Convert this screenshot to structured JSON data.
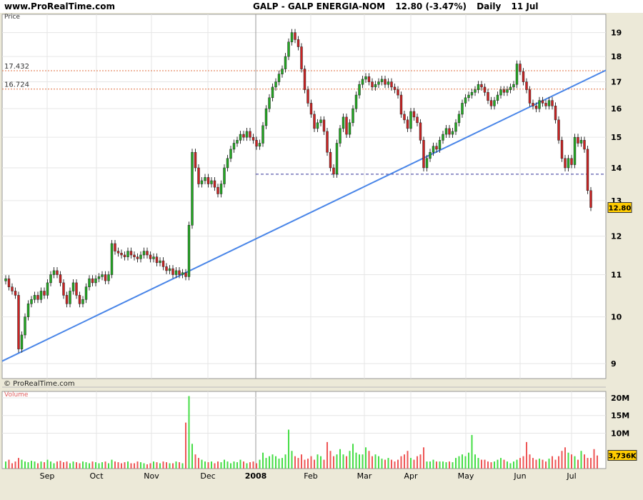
{
  "header": {
    "site": "www.ProRealTime.com",
    "symbol": "GALP - GALP ENERGIA-NOM",
    "quote": "12.80 (-3.47%)",
    "period": "Daily",
    "date": "11 Jul"
  },
  "panel_labels": {
    "price": "Price",
    "volume": "Volume",
    "copyright": "© ProRealTime.com"
  },
  "colors": {
    "up": "#22aa22",
    "down": "#cc2222",
    "trendline": "#4a86e8",
    "level": "#e07040",
    "support": "#333399",
    "vol_up": "#44dd44",
    "vol_down": "#ee5555"
  },
  "chart_data": [
    {
      "type": "candlestick",
      "title": "GALP - GALP ENERGIA-NOM",
      "ylabel": "Price",
      "y_scale": "log",
      "ylim": [
        8.7,
        19.8
      ],
      "y_ticks": [
        9,
        10,
        11,
        12,
        13,
        14,
        15,
        16,
        17,
        18,
        19
      ],
      "x_ticks": [
        "Sep",
        "Oct",
        "Nov",
        "Dec",
        "2008",
        "Feb",
        "Mar",
        "Apr",
        "May",
        "Jun",
        "Jul"
      ],
      "last_price": "12.80",
      "levels": [
        {
          "label": "17.432",
          "value": 17.432,
          "style": "dotted"
        },
        {
          "label": "16.724",
          "value": 16.724,
          "style": "dotted"
        },
        {
          "label": "",
          "value": 13.8,
          "style": "dashed",
          "from": "2008"
        }
      ],
      "trendline": {
        "from": [
          "Aug",
          9.05
        ],
        "to": [
          "Jul",
          17.45
        ]
      },
      "closes": [
        10.9,
        10.7,
        10.6,
        10.5,
        9.3,
        9.6,
        10.0,
        10.3,
        10.4,
        10.5,
        10.4,
        10.6,
        10.5,
        10.8,
        11.0,
        11.1,
        11.0,
        10.8,
        10.5,
        10.3,
        10.6,
        10.8,
        10.5,
        10.3,
        10.4,
        10.7,
        10.9,
        10.8,
        10.9,
        10.95,
        11.0,
        10.85,
        11.0,
        11.8,
        11.6,
        11.55,
        11.5,
        11.45,
        11.6,
        11.5,
        11.45,
        11.4,
        11.5,
        11.6,
        11.5,
        11.4,
        11.45,
        11.3,
        11.35,
        11.2,
        11.1,
        11.15,
        11.0,
        11.1,
        11.0,
        11.05,
        10.95,
        12.3,
        14.5,
        14.0,
        13.5,
        13.6,
        13.7,
        13.5,
        13.6,
        13.4,
        13.2,
        13.5,
        14.0,
        14.3,
        14.6,
        14.8,
        14.9,
        15.1,
        15.0,
        15.2,
        15.0,
        14.9,
        14.7,
        14.8,
        15.4,
        16.0,
        16.4,
        16.8,
        17.0,
        17.3,
        17.5,
        18.0,
        18.6,
        19.0,
        18.7,
        18.4,
        17.5,
        16.7,
        16.2,
        15.8,
        15.3,
        15.5,
        15.6,
        15.2,
        14.5,
        14.0,
        13.8,
        14.8,
        15.3,
        15.7,
        15.1,
        15.5,
        16.0,
        16.5,
        16.9,
        17.1,
        17.2,
        17.0,
        16.8,
        16.9,
        17.0,
        17.1,
        16.9,
        17.0,
        16.8,
        16.7,
        16.5,
        15.8,
        15.6,
        15.3,
        15.9,
        15.7,
        15.5,
        14.9,
        14.0,
        14.3,
        14.5,
        14.7,
        14.6,
        14.9,
        15.1,
        15.3,
        15.1,
        15.2,
        15.5,
        15.8,
        16.2,
        16.4,
        16.5,
        16.6,
        16.7,
        16.9,
        16.8,
        16.6,
        16.3,
        16.1,
        16.3,
        16.5,
        16.7,
        16.6,
        16.7,
        16.8,
        16.9,
        17.7,
        17.4,
        17.0,
        16.7,
        16.2,
        16.1,
        16.0,
        16.3,
        16.2,
        16.1,
        16.3,
        16.1,
        15.6,
        14.9,
        14.3,
        14.0,
        14.3,
        14.1,
        15.0,
        14.8,
        14.9,
        14.6,
        13.3,
        12.8
      ],
      "volume": {
        "unit": "M",
        "last": "3,736K",
        "y_ticks": [
          "10M",
          "15M",
          "20M"
        ],
        "ylim": [
          0,
          21
        ],
        "values": [
          2.0,
          2.5,
          1.5,
          2.0,
          3.0,
          2.5,
          2.0,
          1.8,
          2.2,
          2.0,
          1.5,
          2.0,
          1.8,
          2.5,
          2.0,
          1.5,
          2.0,
          2.2,
          1.8,
          2.0,
          1.5,
          2.0,
          1.8,
          1.5,
          2.0,
          1.8,
          1.5,
          2.0,
          1.8,
          1.5,
          1.8,
          2.0,
          1.5,
          2.5,
          2.0,
          1.8,
          1.5,
          1.8,
          2.0,
          1.5,
          1.5,
          2.0,
          1.8,
          1.5,
          1.2,
          1.5,
          2.0,
          1.8,
          1.5,
          2.0,
          1.8,
          1.5,
          1.5,
          2.0,
          1.8,
          1.5,
          13.0,
          20.5,
          7.0,
          4.0,
          3.0,
          2.5,
          2.0,
          1.8,
          2.0,
          1.5,
          2.0,
          1.8,
          2.5,
          2.0,
          1.5,
          2.0,
          1.8,
          2.5,
          2.0,
          1.5,
          1.8,
          2.0,
          1.5,
          2.5,
          4.5,
          3.0,
          3.5,
          4.0,
          3.5,
          2.8,
          3.0,
          4.0,
          11.0,
          5.0,
          3.5,
          3.0,
          4.0,
          2.5,
          2.8,
          3.5,
          2.5,
          4.0,
          3.5,
          2.5,
          7.5,
          5.0,
          3.5,
          4.0,
          5.5,
          4.0,
          3.5,
          5.0,
          7.0,
          4.5,
          4.0,
          4.0,
          6.0,
          5.0,
          3.5,
          4.0,
          3.5,
          2.8,
          2.5,
          3.0,
          2.5,
          2.0,
          2.5,
          3.5,
          4.0,
          5.0,
          3.0,
          2.5,
          3.5,
          4.0,
          6.0,
          2.0,
          2.0,
          2.5,
          2.0,
          2.0,
          2.0,
          1.8,
          2.0,
          1.8,
          3.0,
          3.5,
          4.0,
          3.5,
          4.5,
          9.5,
          4.0,
          3.0,
          2.5,
          2.5,
          2.0,
          1.8,
          2.0,
          2.5,
          3.0,
          2.5,
          2.0,
          1.5,
          2.0,
          2.5,
          3.0,
          3.5,
          7.5,
          4.0,
          3.0,
          2.5,
          2.8,
          2.5,
          2.0,
          2.8,
          3.5,
          2.5,
          3.5,
          5.0,
          6.0,
          4.5,
          4.0,
          3.5,
          2.5,
          5.0,
          4.0,
          3.0,
          3.0,
          5.5,
          3.7
        ]
      }
    }
  ]
}
